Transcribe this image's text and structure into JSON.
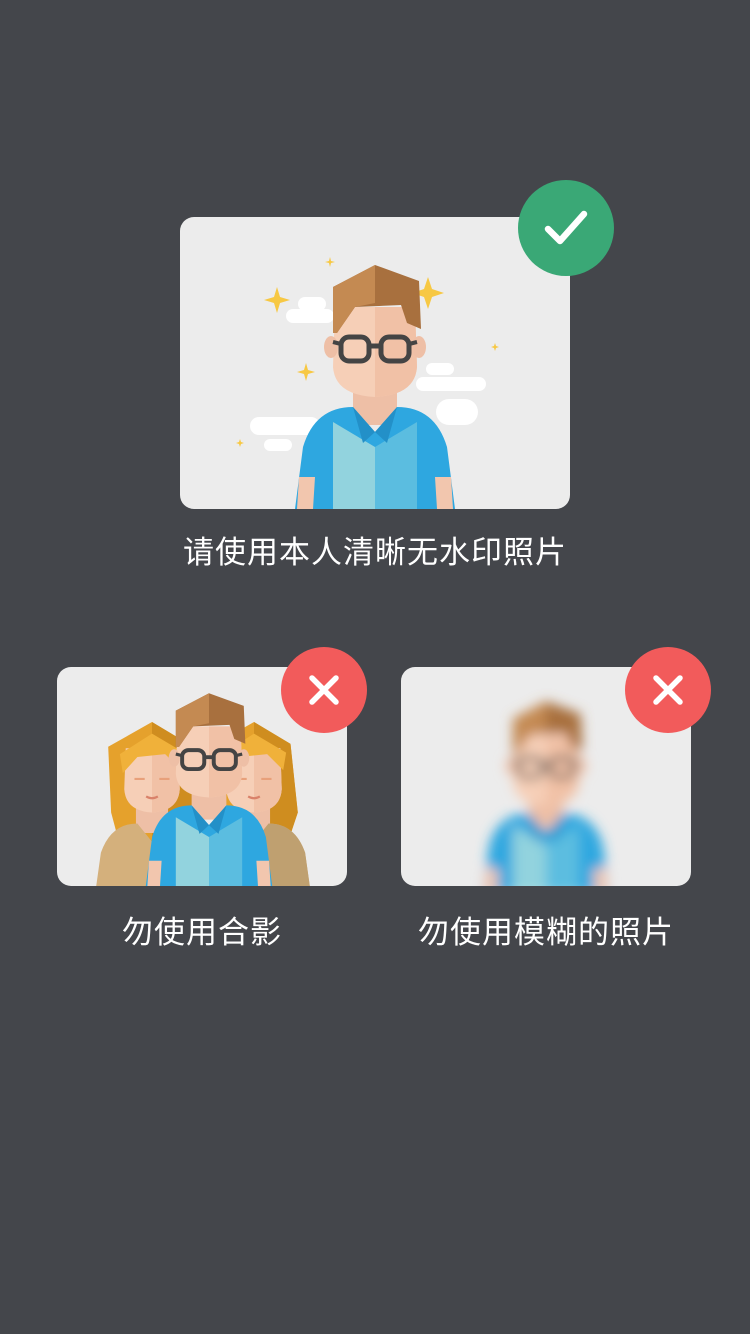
{
  "good_example": {
    "caption": "请使用本人清晰无水印照片",
    "badge_icon": "check-icon",
    "badge_color": "#3aa876"
  },
  "bad_examples": [
    {
      "caption": "勿使用合影",
      "badge_icon": "close-icon",
      "badge_color": "#f25b5b"
    },
    {
      "caption": "勿使用模糊的照片",
      "badge_icon": "close-icon",
      "badge_color": "#f25b5b"
    }
  ],
  "colors": {
    "background": "#44464b",
    "card": "#ececec",
    "shirt_light": "#92d3de",
    "shirt_dark": "#5bbde0",
    "vest_blue": "#2ea7e0",
    "hair_brown": "#b77b44",
    "hair_yellow": "#e5a12c",
    "skin": "#f6cfb7",
    "sparkle": "#f7c843"
  }
}
